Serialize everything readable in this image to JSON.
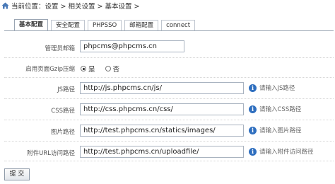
{
  "breadcrumb": {
    "text": "当前位置：设置 > 相关设置 > 基本设置 >"
  },
  "tabs": [
    {
      "label": "基本配置",
      "active": true
    },
    {
      "label": "安全配置",
      "active": false
    },
    {
      "label": "PHPSSO",
      "active": false
    },
    {
      "label": "邮箱配置",
      "active": false
    },
    {
      "label": "connect",
      "active": false
    }
  ],
  "form": {
    "admin_email": {
      "label": "管理员邮箱",
      "value": "phpcms@phpcms.cn"
    },
    "gzip": {
      "label": "启用页面Gzip压缩",
      "options": [
        "是",
        "否"
      ],
      "selected": "是"
    },
    "js_path": {
      "label": "JS路径",
      "value": "http://js.phpcms.cn/js/",
      "hint": "请输入JS路径"
    },
    "css_path": {
      "label": "CSS路径",
      "value": "http://css.phpcms.cn/css/",
      "hint": "请输入CSS路径"
    },
    "img_path": {
      "label": "图片路径",
      "value": "http://test.phpcms.cn/statics/images/",
      "hint": "请输入图片路径"
    },
    "upload_url": {
      "label": "附件URL访问路径",
      "value": "http://test.phpcms.cn/uploadfile/",
      "hint": "请输入附件访问路径"
    }
  },
  "submit_label": "提 交",
  "colors": {
    "info_icon": "#2f6fbf",
    "border": "#9aa5b3"
  }
}
